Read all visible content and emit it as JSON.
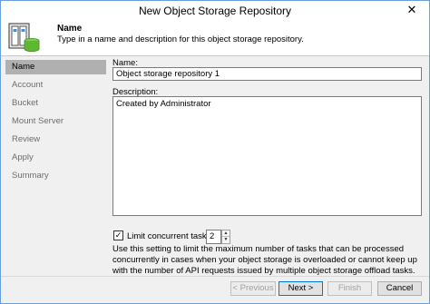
{
  "window": {
    "title": "New Object Storage Repository",
    "close_glyph": "✕"
  },
  "header": {
    "title": "Name",
    "description": "Type in a name and description for this object storage repository.",
    "icon": "object-storage-repository-icon"
  },
  "sidebar": {
    "items": [
      {
        "label": "Name",
        "active": true
      },
      {
        "label": "Account",
        "active": false
      },
      {
        "label": "Bucket",
        "active": false
      },
      {
        "label": "Mount Server",
        "active": false
      },
      {
        "label": "Review",
        "active": false
      },
      {
        "label": "Apply",
        "active": false
      },
      {
        "label": "Summary",
        "active": false
      }
    ]
  },
  "form": {
    "name_label": "Name:",
    "name_value": "Object storage repository 1",
    "description_label": "Description:",
    "description_value": "Created by Administrator",
    "limit_checkbox_label": "Limit concurrent tasks to:",
    "limit_checked": true,
    "limit_value": "2",
    "help_text": "Use this setting to limit the maximum number of tasks that can be processed concurrently in cases when your object storage is overloaded or cannot keep up with the number of API requests issued by multiple object storage offload tasks."
  },
  "buttons": {
    "previous": "< Previous",
    "next": "Next >",
    "finish": "Finish",
    "cancel": "Cancel"
  },
  "colors": {
    "accent_border": "#0078d7",
    "sidebar_active": "#b0b0b0",
    "icon_green": "#5fb832"
  }
}
